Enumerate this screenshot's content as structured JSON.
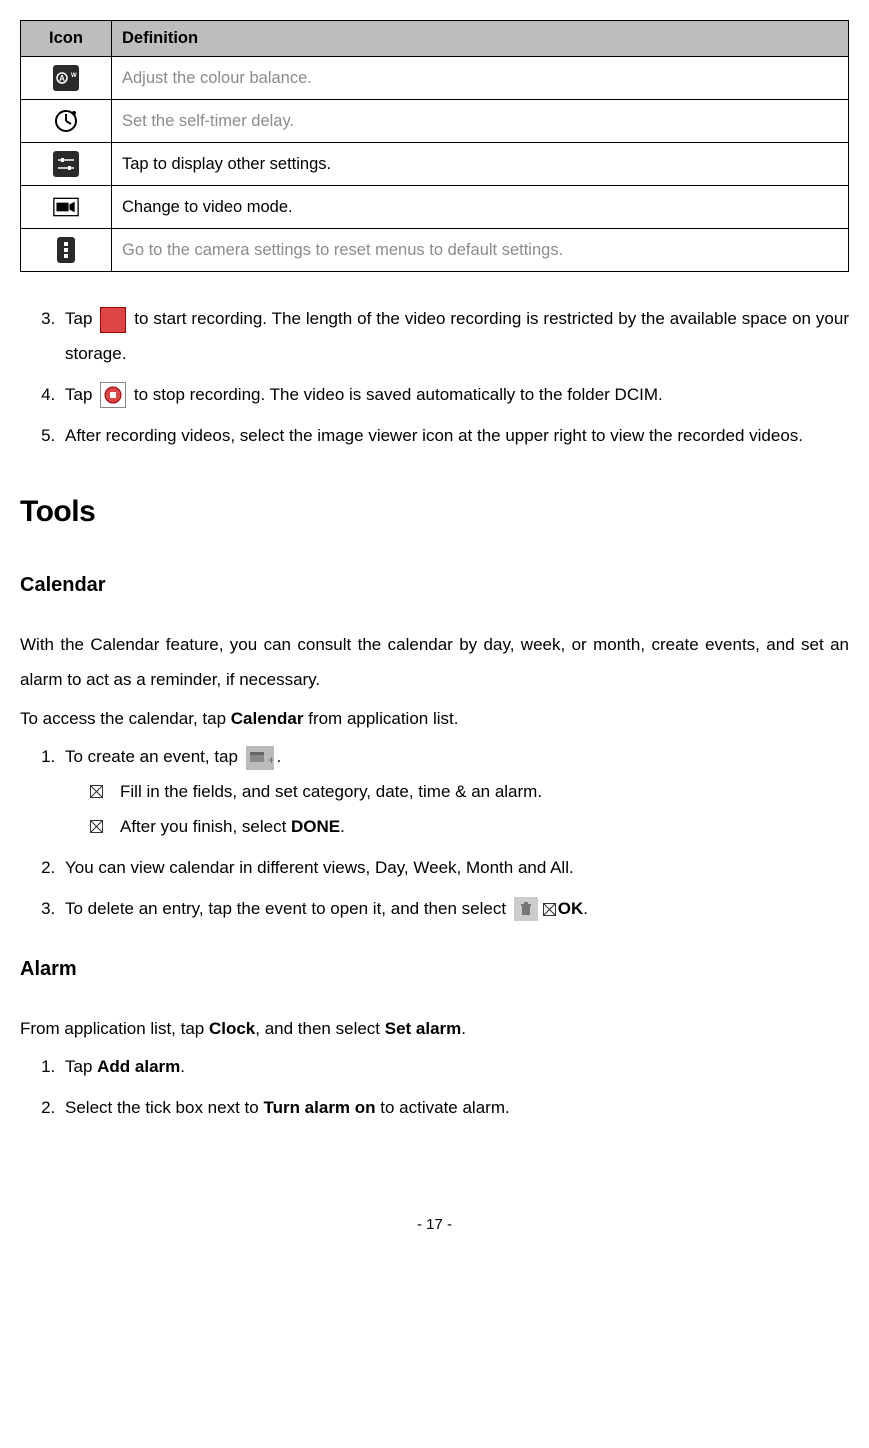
{
  "table": {
    "headers": {
      "icon": "Icon",
      "definition": "Definition"
    },
    "rows": [
      {
        "definition": "Adjust the colour balance.",
        "muted": true
      },
      {
        "definition": "Set the self-timer delay.",
        "muted": true
      },
      {
        "definition": "Tap to display other settings.",
        "muted": false
      },
      {
        "definition": "Change to video mode.",
        "muted": false
      },
      {
        "definition": "Go to the camera settings to reset menus to default settings.",
        "muted": true
      }
    ]
  },
  "steps_a": {
    "3_pre": "Tap ",
    "3_post": " to start recording. The length of the video recording is restricted by the available space on your storage.",
    "4_pre": "Tap ",
    "4_post": " to stop recording. The video is saved automatically to the folder DCIM.",
    "5": "After recording videos, select the image viewer icon at the upper right to view the recorded videos."
  },
  "heading_tools": "Tools",
  "heading_calendar": "Calendar",
  "calendar_intro": "With the Calendar feature, you can consult the calendar by day, week, or month, create events, and set an alarm to act as a reminder, if necessary.",
  "calendar_access_pre": "To access the calendar, tap ",
  "calendar_access_bold": "Calendar",
  "calendar_access_post": " from application list.",
  "calendar_steps": {
    "1_pre": "To create an event, tap ",
    "1_post": ".",
    "1_sub1": "Fill in the fields, and set category, date, time & an alarm.",
    "1_sub2_pre": "After you finish, select ",
    "1_sub2_bold": "DONE",
    "1_sub2_post": ".",
    "2": "You can view calendar in different views, Day, Week, Month and All.",
    "3_pre": "To delete an entry, tap the event to open it, and then select ",
    "3_bold": "OK",
    "3_post": "."
  },
  "heading_alarm": "Alarm",
  "alarm_intro_pre": "From application list, tap ",
  "alarm_intro_bold1": "Clock",
  "alarm_intro_mid": ", and then select ",
  "alarm_intro_bold2": "Set alarm",
  "alarm_intro_post": ".",
  "alarm_steps": {
    "1_pre": "Tap ",
    "1_bold": "Add alarm",
    "1_post": ".",
    "2_pre": "Select the tick box next to ",
    "2_bold": "Turn alarm on",
    "2_post": " to activate alarm."
  },
  "footer": "- 17 -"
}
